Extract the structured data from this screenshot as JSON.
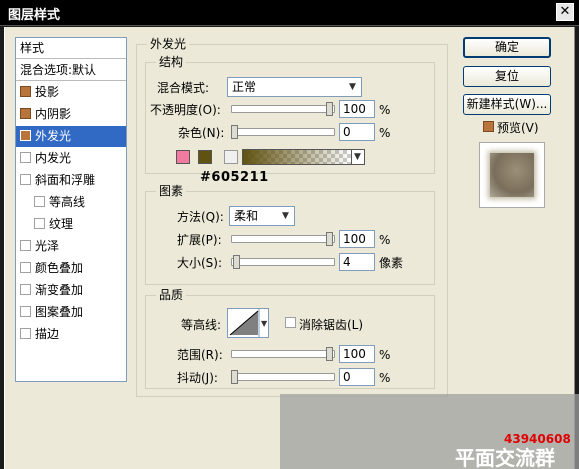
{
  "window": {
    "title": "图层样式",
    "close_glyph": "✕"
  },
  "left_panel": {
    "items": [
      {
        "label": "样式",
        "checkbox": "none"
      },
      {
        "label": "混合选项:默认",
        "checkbox": "none"
      },
      {
        "label": "投影",
        "checkbox": "on"
      },
      {
        "label": "内阴影",
        "checkbox": "on"
      },
      {
        "label": "外发光",
        "checkbox": "on"
      },
      {
        "label": "内发光",
        "checkbox": "off"
      },
      {
        "label": "斜面和浮雕",
        "checkbox": "off"
      },
      {
        "label": "等高线",
        "checkbox": "off"
      },
      {
        "label": "纹理",
        "checkbox": "off"
      },
      {
        "label": "光泽",
        "checkbox": "off"
      },
      {
        "label": "颜色叠加",
        "checkbox": "off"
      },
      {
        "label": "渐变叠加",
        "checkbox": "off"
      },
      {
        "label": "图案叠加",
        "checkbox": "off"
      },
      {
        "label": "描边",
        "checkbox": "off"
      }
    ]
  },
  "outer_glow": {
    "title": "外发光",
    "structure": {
      "title": "结构",
      "blend_mode_label": "混合模式:",
      "blend_mode_value": "正常",
      "opacity_label": "不透明度(O):",
      "opacity_value": "100",
      "opacity_level": 1.0,
      "noise_label": "杂色(N):",
      "noise_value": "0",
      "noise_level": 0.0,
      "percent": "%",
      "glow_swatch_color": "#f07aa0",
      "selected_color": "#605211",
      "color_annotation": "#605211"
    },
    "elements": {
      "title": "图素",
      "technique_label": "方法(Q):",
      "technique_value": "柔和",
      "spread_label": "扩展(P):",
      "spread_value": "100",
      "spread_level": 1.0,
      "size_label": "大小(S):",
      "size_value": "4",
      "size_level": 0.02,
      "percent": "%",
      "px_unit": "像素"
    },
    "quality": {
      "title": "品质",
      "contour_label": "等高线:",
      "antialias_label": "消除锯齿(L)",
      "range_label": "范围(R):",
      "range_value": "100",
      "range_level": 1.0,
      "jitter_label": "抖动(J):",
      "jitter_value": "0",
      "jitter_level": 0.0,
      "percent": "%"
    }
  },
  "buttons": {
    "ok": "确定",
    "reset": "复位",
    "new_style": "新建样式(W)...",
    "preview_label": "预览(V)"
  },
  "watermark": {
    "number": "43940608",
    "text": "平面交流群"
  }
}
